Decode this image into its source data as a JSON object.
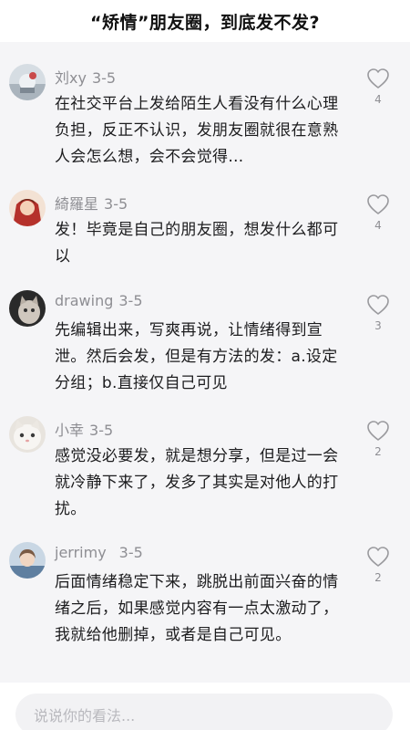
{
  "header": {
    "title": "“矫情”朋友圈，到底发不发?"
  },
  "comments": [
    {
      "username": "刘xy",
      "date": "3-5",
      "text": "在社交平台上发给陌生人看没有什么心理负担，反正不认识，发朋友圈就很在意熟人会怎么想，会不会觉得…",
      "likes": "4"
    },
    {
      "username": "綺羅星",
      "date": "3-5",
      "text": "发！毕竟是自己的朋友圈，想发什么都可以",
      "likes": "4"
    },
    {
      "username": "drawing",
      "date": "3-5",
      "text": "先编辑出来，写爽再说，让情绪得到宣泄。然后会发，但是有方法的发：a.设定分组；b.直接仅自己可见",
      "likes": "3"
    },
    {
      "username": "小幸",
      "date": "3-5",
      "text": "感觉没必要发，就是想分享，但是过一会就冷静下来了，发多了其实是对他人的打扰。",
      "likes": "2"
    },
    {
      "username": "jerrimy",
      "date": "3-5",
      "text": "后面情绪稳定下来，跳脱出前面兴奋的情绪之后，如果感觉内容有一点太激动了，我就给他删掉，或者是自己可见。",
      "likes": "2"
    }
  ],
  "footer": {
    "input_placeholder": "说说你的看法..."
  },
  "icons": {
    "like": "heart-outline-icon"
  },
  "colors": {
    "background": "#f5f5f7",
    "secondary_text": "#8e8e93",
    "placeholder": "#b9b9be"
  }
}
